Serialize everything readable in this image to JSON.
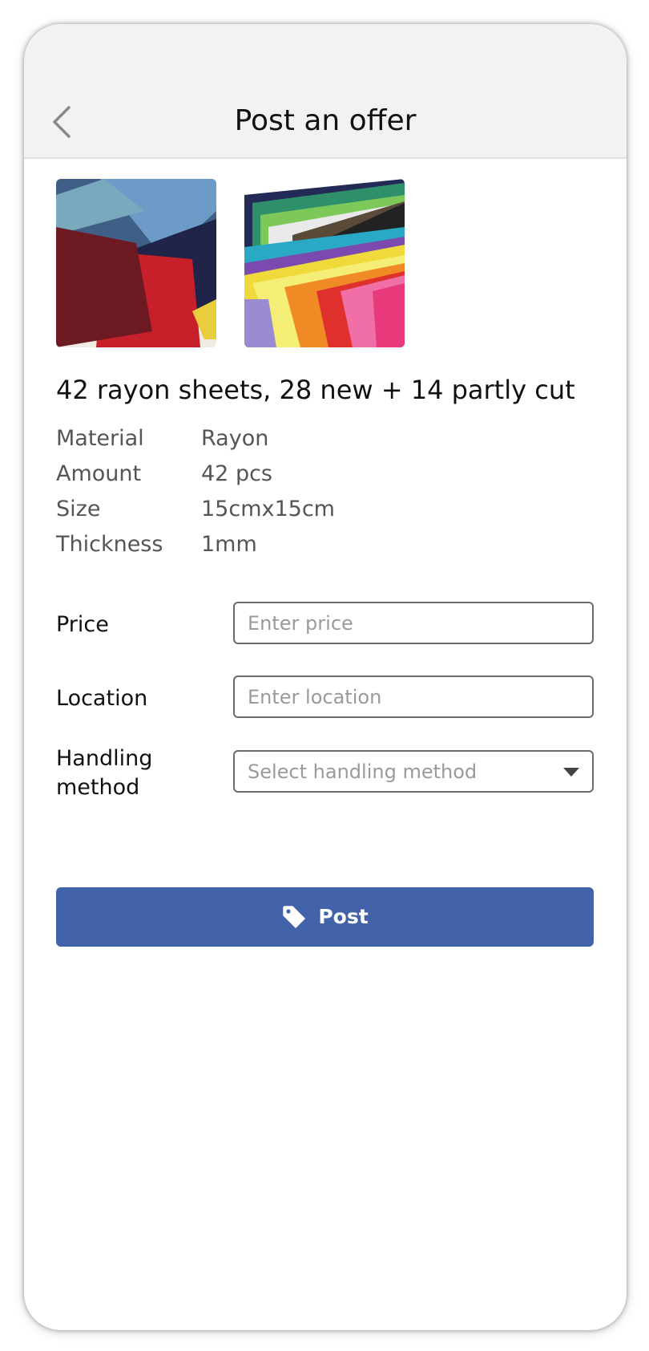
{
  "header": {
    "title": "Post an offer",
    "back_icon": "chevron-left-icon"
  },
  "product": {
    "images": [
      {
        "alt": "rayon sheets pile"
      },
      {
        "alt": "colorful rayon sheets fan"
      }
    ],
    "title": "42 rayon sheets, 28 new + 14 partly cut",
    "specs": [
      {
        "label": "Material",
        "value": "Rayon"
      },
      {
        "label": "Amount",
        "value": "42 pcs"
      },
      {
        "label": "Size",
        "value": "15cmx15cm"
      },
      {
        "label": "Thickness",
        "value": "1mm"
      }
    ]
  },
  "form": {
    "price": {
      "label": "Price",
      "placeholder": "Enter price",
      "value": ""
    },
    "location": {
      "label": "Location",
      "placeholder": "Enter location",
      "value": ""
    },
    "handling": {
      "label": "Handling method",
      "placeholder": "Select handling method"
    }
  },
  "actions": {
    "post_label": "Post",
    "post_icon": "tag-icon",
    "accent_color": "#4263aa"
  }
}
